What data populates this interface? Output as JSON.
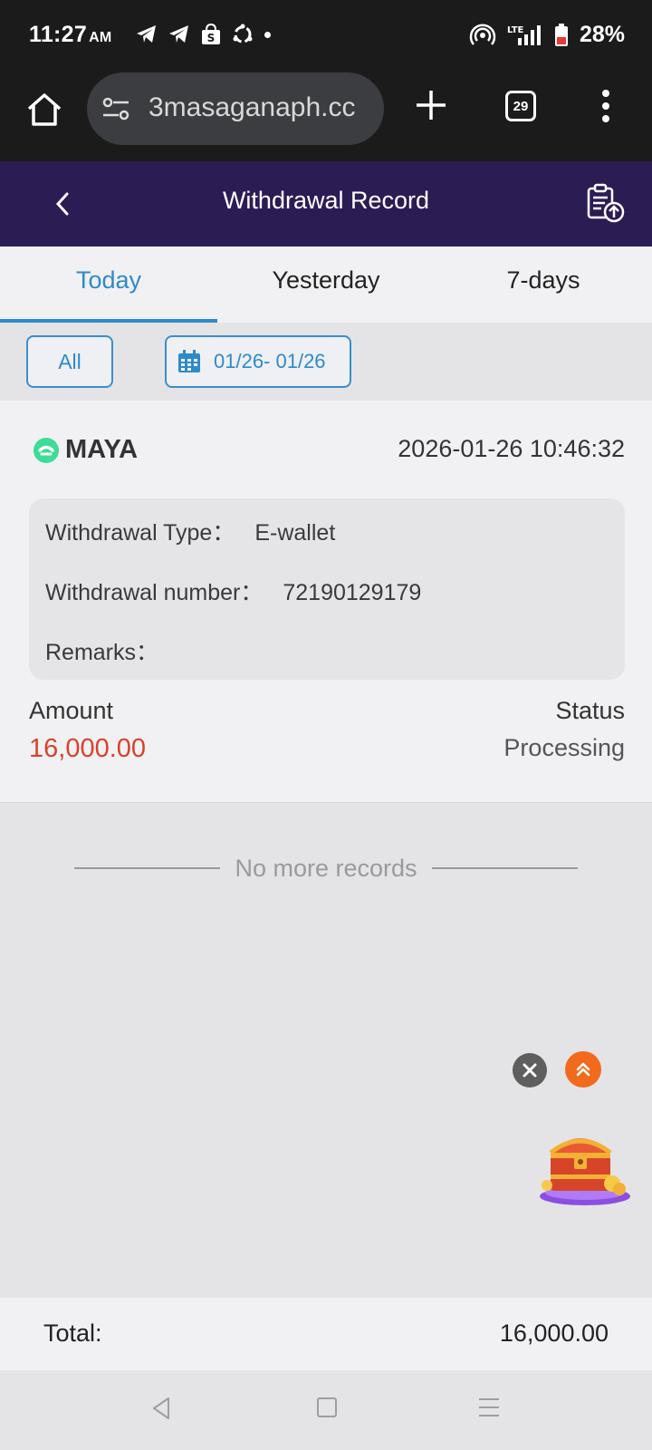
{
  "status_bar": {
    "time": "11:27",
    "ampm": "AM",
    "battery": "28%",
    "icons_left": [
      "telegram-icon",
      "telegram-icon",
      "shopee-icon",
      "sync-icon",
      "dot-icon"
    ],
    "icons_right": [
      "hotspot-icon",
      "lte-signal-icon",
      "battery-icon"
    ]
  },
  "browser": {
    "url": "3masaganaph.cc",
    "tab_count": "29"
  },
  "header": {
    "title": "Withdrawal Record"
  },
  "tabs": [
    {
      "label": "Today",
      "active": true
    },
    {
      "label": "Yesterday",
      "active": false
    },
    {
      "label": "7-days",
      "active": false
    }
  ],
  "filters": {
    "all_label": "All",
    "date_range": "01/26- 01/26"
  },
  "record": {
    "brand": "MAYA",
    "datetime": "2026-01-26 10:46:32",
    "type_label": "Withdrawal Type：",
    "type_value": "E-wallet",
    "number_label": "Withdrawal number：",
    "number_value": "72190129179",
    "remarks_label": "Remarks：",
    "remarks_value": "",
    "amount_label": "Amount",
    "amount_value": "16,000.00",
    "status_label": "Status",
    "status_value": "Processing"
  },
  "no_more_text": "No more records",
  "total": {
    "label": "Total:",
    "value": "16,000.00"
  },
  "colors": {
    "header_bg": "#2c1c54",
    "accent_blue": "#2f8ac9",
    "amount_red": "#d9412e",
    "maya_green": "#3ddc97",
    "up_button": "#f26a1b"
  }
}
